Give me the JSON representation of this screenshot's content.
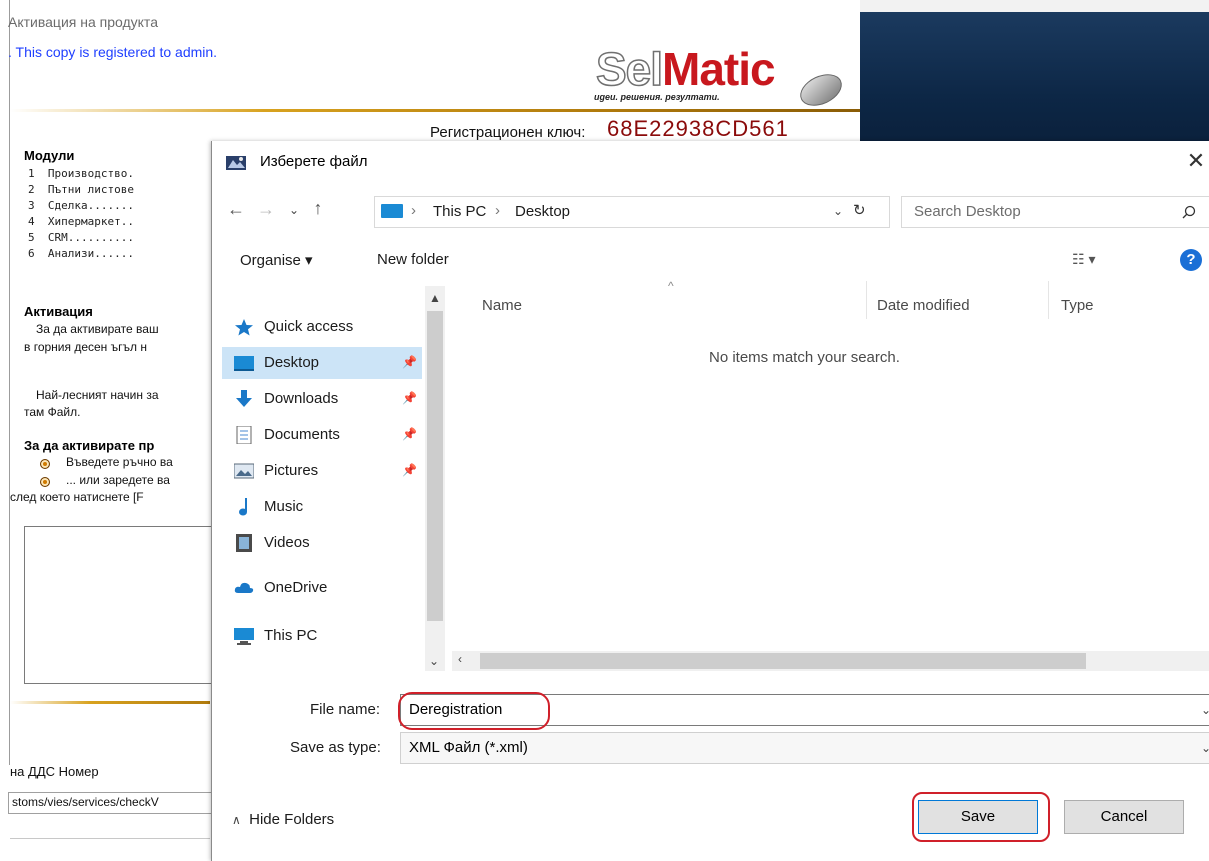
{
  "background_app": {
    "title": "Активация на продукта",
    "registered_text": ". This copy is registered to  admin.",
    "logo": {
      "sel": "Sel",
      "matic": "Matic",
      "tagline": "ugeu. решения. резултати."
    },
    "reg_key_label": "Регистрационен ключ:",
    "reg_key_value": "68E22938CD561",
    "modules_heading": "Модули",
    "modules": [
      "1  Производство.",
      "2  Пътни листове",
      "3  Сделка.......",
      "4  Хипермаркет..",
      "5  CRM..........",
      "6  Анализи......"
    ],
    "activation_heading": "Активация",
    "activation_lines": [
      "За да активирате ваш",
      "в горния десен ъгъл н",
      "Най-лесният начин за",
      "там Файл."
    ],
    "activate_heading": "За да активирате пр",
    "bullets": [
      "Въведете ръчно ва",
      "... или заредете ва"
    ],
    "after_bullets": "след което натиснете [F",
    "vat_label": "на ДДС Номер",
    "vat_url": "stoms/vies/services/checkV"
  },
  "dialog": {
    "title": "Изберете файл",
    "close_glyph": "✕",
    "address": {
      "crumbs": [
        "This PC",
        "Desktop"
      ],
      "separator": "›"
    },
    "search_placeholder": "Search Desktop",
    "toolbar": {
      "organise": "Organise ▾",
      "new_folder": "New folder",
      "help": "?"
    },
    "nav_items": [
      {
        "label": "Quick access",
        "icon": "star-icon",
        "pinned": false,
        "selected": false
      },
      {
        "label": "Desktop",
        "icon": "desktop-icon",
        "pinned": true,
        "selected": true
      },
      {
        "label": "Downloads",
        "icon": "download-icon",
        "pinned": true,
        "selected": false
      },
      {
        "label": "Documents",
        "icon": "documents-icon",
        "pinned": true,
        "selected": false
      },
      {
        "label": "Pictures",
        "icon": "pictures-icon",
        "pinned": true,
        "selected": false
      },
      {
        "label": "Music",
        "icon": "music-icon",
        "pinned": false,
        "selected": false
      },
      {
        "label": "Videos",
        "icon": "videos-icon",
        "pinned": false,
        "selected": false
      },
      {
        "label": "OneDrive",
        "icon": "cloud-icon",
        "pinned": false,
        "selected": false
      },
      {
        "label": "This PC",
        "icon": "computer-icon",
        "pinned": false,
        "selected": false
      }
    ],
    "columns": [
      "Name",
      "Date modified",
      "Type"
    ],
    "empty_message": "No items match your search.",
    "file_name_label": "File name:",
    "file_name_value": "Deregistration",
    "save_as_type_label": "Save as type:",
    "save_as_type_value": "XML Файл (*.xml)",
    "hide_folders": "Hide Folders",
    "save_button": "Save",
    "cancel_button": "Cancel"
  },
  "colors": {
    "highlight_ring": "#d0202a",
    "nav_selected": "#cce4f7",
    "accent": "#0078d7",
    "reg_key": "#8a0a0a"
  }
}
